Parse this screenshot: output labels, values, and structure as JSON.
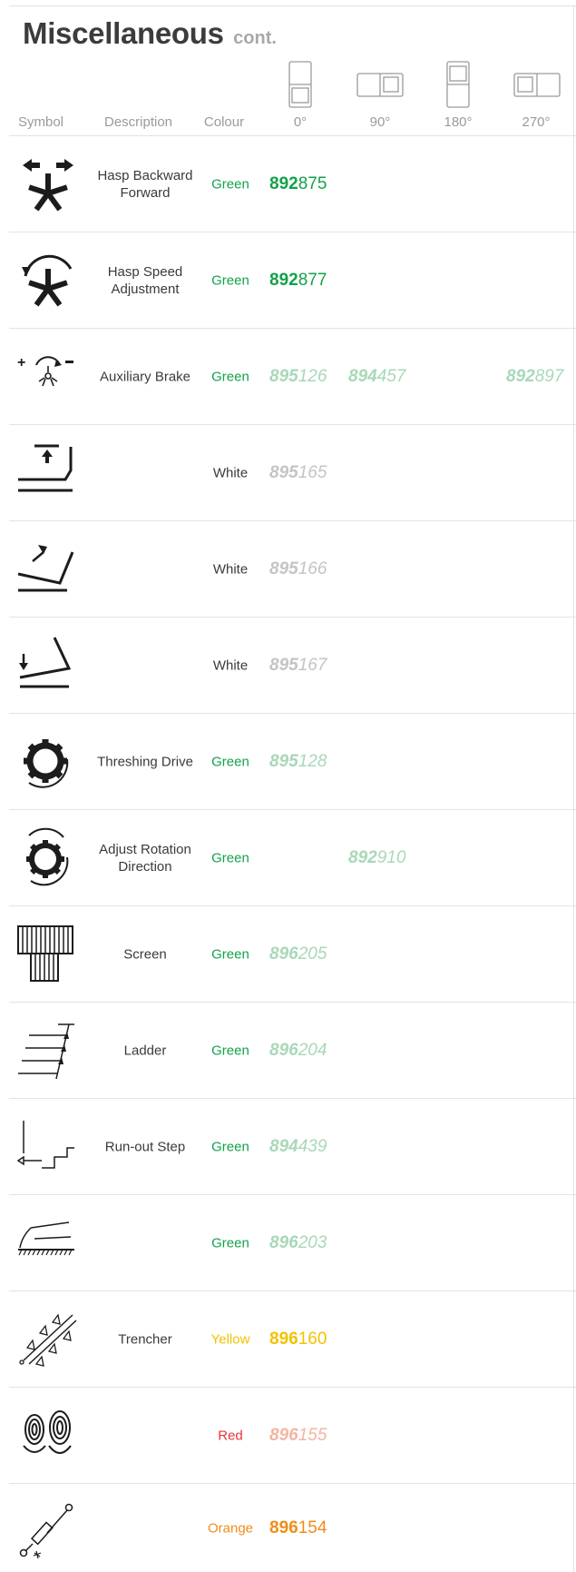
{
  "title": {
    "main": "Miscellaneous",
    "suffix": "cont."
  },
  "columns": {
    "symbol": "Symbol",
    "description": "Description",
    "colour": "Colour",
    "deg0": "0°",
    "deg90": "90°",
    "deg180": "180°",
    "deg270": "270°"
  },
  "rows": [
    {
      "symbol": "hasp-backward-forward-icon",
      "description": "Hasp Backward Forward",
      "colour": "Green",
      "codes": {
        "deg0": {
          "prefix": "892",
          "suffix": "875"
        }
      }
    },
    {
      "symbol": "hasp-speed-icon",
      "description": "Hasp Speed Adjustment",
      "colour": "Green",
      "codes": {
        "deg0": {
          "prefix": "892",
          "suffix": "877"
        }
      }
    },
    {
      "symbol": "auxiliary-brake-icon",
      "description": "Auxiliary Brake",
      "colour": "Green",
      "codes": {
        "deg0": {
          "prefix": "895",
          "suffix": "126"
        },
        "deg90": {
          "prefix": "894",
          "suffix": "457"
        },
        "deg270": {
          "prefix": "892",
          "suffix": "897"
        }
      }
    },
    {
      "symbol": "tray-raise-icon",
      "description": "",
      "colour": "White",
      "codes": {
        "deg0": {
          "prefix": "895",
          "suffix": "165"
        }
      }
    },
    {
      "symbol": "tray-tilt-up-icon",
      "description": "",
      "colour": "White",
      "codes": {
        "deg0": {
          "prefix": "895",
          "suffix": "166"
        }
      }
    },
    {
      "symbol": "tray-tilt-down-icon",
      "description": "",
      "colour": "White",
      "codes": {
        "deg0": {
          "prefix": "895",
          "suffix": "167"
        }
      }
    },
    {
      "symbol": "threshing-drive-icon",
      "description": "Threshing Drive",
      "colour": "Green",
      "codes": {
        "deg0": {
          "prefix": "895",
          "suffix": "128"
        }
      }
    },
    {
      "symbol": "rotation-direction-icon",
      "description": "Adjust Rotation Direction",
      "colour": "Green",
      "codes": {
        "deg90": {
          "prefix": "892",
          "suffix": "910"
        }
      }
    },
    {
      "symbol": "screen-icon",
      "description": "Screen",
      "colour": "Green",
      "codes": {
        "deg0": {
          "prefix": "896",
          "suffix": "205"
        }
      }
    },
    {
      "symbol": "ladder-icon",
      "description": "Ladder",
      "colour": "Green",
      "codes": {
        "deg0": {
          "prefix": "896",
          "suffix": "204"
        }
      }
    },
    {
      "symbol": "run-out-step-icon",
      "description": "Run-out Step",
      "colour": "Green",
      "codes": {
        "deg0": {
          "prefix": "894",
          "suffix": "439"
        }
      }
    },
    {
      "symbol": "blade-icon",
      "description": "",
      "colour": "Green",
      "codes": {
        "deg0": {
          "prefix": "896",
          "suffix": "203"
        }
      }
    },
    {
      "symbol": "trencher-icon",
      "description": "Trencher",
      "colour": "Yellow",
      "codes": {
        "deg0": {
          "prefix": "896",
          "suffix": "160"
        }
      }
    },
    {
      "symbol": "footprints-icon",
      "description": "",
      "colour": "Red",
      "codes": {
        "deg0": {
          "prefix": "896",
          "suffix": "155"
        }
      }
    },
    {
      "symbol": "hydraulic-cylinder-icon",
      "description": "",
      "colour": "Orange",
      "codes": {
        "deg0": {
          "prefix": "896",
          "suffix": "154"
        }
      }
    }
  ],
  "colors": {
    "green": "#14a04b",
    "yellow": "#f2c200",
    "red": "#e8343a",
    "orange": "#ef8d1a",
    "white_text": "#3a3a3a"
  }
}
